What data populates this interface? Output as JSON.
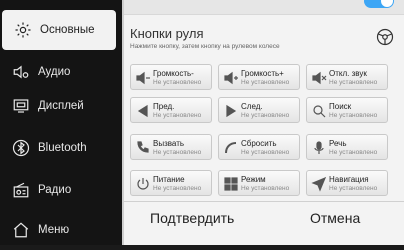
{
  "sidebar": {
    "items": [
      {
        "label": "Основные",
        "icon": "gear-icon",
        "active": true
      },
      {
        "label": "Аудио",
        "icon": "speaker-icon",
        "active": false
      },
      {
        "label": "Дисплей",
        "icon": "display-icon",
        "active": false
      },
      {
        "label": "Bluetooth",
        "icon": "bluetooth-icon",
        "active": false
      },
      {
        "label": "Радио",
        "icon": "radio-icon",
        "active": false
      },
      {
        "label": "Меню",
        "icon": "home-icon",
        "active": false
      }
    ]
  },
  "panel": {
    "title": "Кнопки руля",
    "subtitle": "Нажмите кнопку, затем кнопку на рулевом колесе",
    "toggle_on": true,
    "buttons": [
      {
        "label": "Громкость-",
        "status": "Не установлено",
        "icon": "volume-down-icon"
      },
      {
        "label": "Громкость+",
        "status": "Не установлено",
        "icon": "volume-up-icon"
      },
      {
        "label": "Откл. звук",
        "status": "Не установлено",
        "icon": "mute-icon"
      },
      {
        "label": "Пред.",
        "status": "Не установлено",
        "icon": "previous-icon"
      },
      {
        "label": "След.",
        "status": "Не установлено",
        "icon": "next-icon"
      },
      {
        "label": "Поиск",
        "status": "Не установлено",
        "icon": "search-icon"
      },
      {
        "label": "Вызвать",
        "status": "Не установлено",
        "icon": "phone-call-icon"
      },
      {
        "label": "Сбросить",
        "status": "Не установлено",
        "icon": "hang-up-icon"
      },
      {
        "label": "Речь",
        "status": "Не установлено",
        "icon": "microphone-icon"
      },
      {
        "label": "Питание",
        "status": "Не установлено",
        "icon": "power-icon"
      },
      {
        "label": "Режим",
        "status": "Не установлено",
        "icon": "mode-icon"
      },
      {
        "label": "Навигация",
        "status": "Не установлено",
        "icon": "navigation-icon"
      }
    ]
  },
  "footer": {
    "confirm_label": "Подтвердить",
    "cancel_label": "Отмена"
  },
  "colors": {
    "accent": "#3da6f5",
    "sidebar_bg": "#141414",
    "panel_bg": "#f3f3f3"
  }
}
